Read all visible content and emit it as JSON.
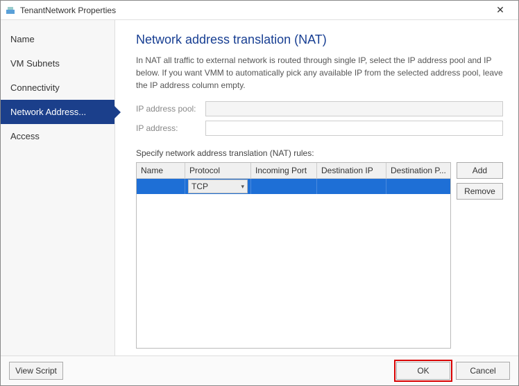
{
  "window": {
    "title": "TenantNetwork Properties",
    "icon": "app-icon"
  },
  "sidebar": {
    "items": [
      {
        "label": "Name"
      },
      {
        "label": "VM Subnets"
      },
      {
        "label": "Connectivity"
      },
      {
        "label": "Network Address..."
      },
      {
        "label": "Access"
      }
    ],
    "activeIndex": 3
  },
  "panel": {
    "heading": "Network address translation (NAT)",
    "description": "In NAT all traffic to external network is routed through single IP, select the IP address pool and IP below. If you want VMM to automatically pick any available IP from the selected address pool, leave the IP address column empty.",
    "ipPoolLabel": "IP address pool:",
    "ipPoolValue": "",
    "ipAddrLabel": "IP address:",
    "ipAddrValue": "",
    "rulesLabel": "Specify network address translation (NAT) rules:",
    "columns": {
      "name": "Name",
      "protocol": "Protocol",
      "incoming": "Incoming Port",
      "destIp": "Destination IP",
      "destPort": "Destination P..."
    },
    "rows": [
      {
        "name": "",
        "protocol": "TCP",
        "incoming": "",
        "destIp": "",
        "destPort": ""
      }
    ],
    "addLabel": "Add",
    "removeLabel": "Remove"
  },
  "footer": {
    "viewScript": "View Script",
    "ok": "OK",
    "cancel": "Cancel"
  }
}
